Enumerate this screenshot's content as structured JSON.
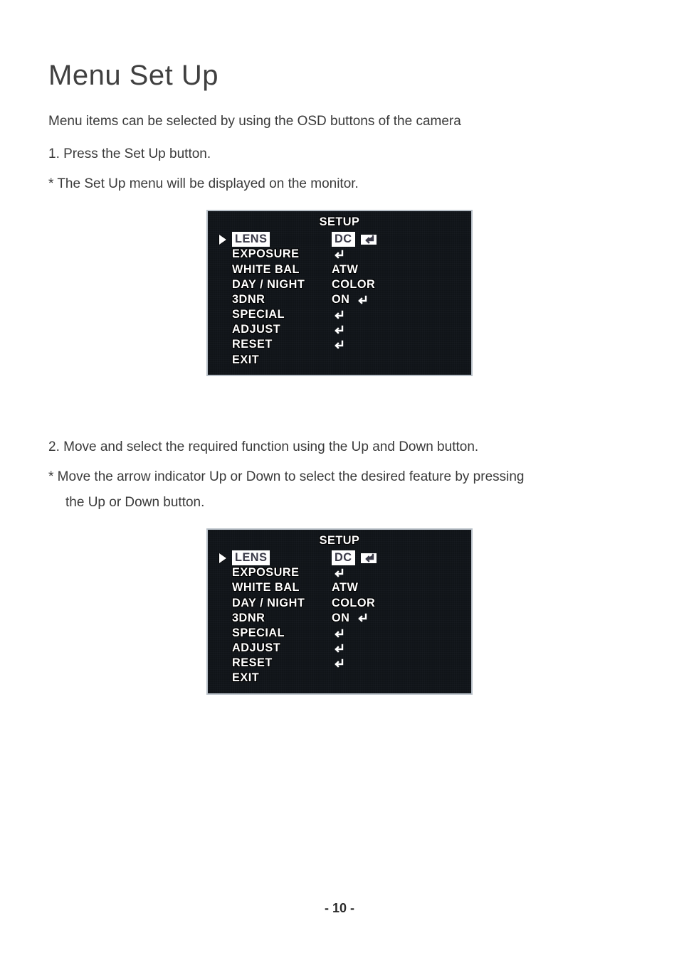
{
  "title": "Menu Set Up",
  "intro": "Menu items can be selected by using the OSD buttons of the camera",
  "step1": "1. Press the Set Up button.",
  "step1_note": "* The Set Up menu will be displayed on the monitor.",
  "step2": "2. Move and select the required function using the Up and Down button.",
  "step2_note": "* Move the arrow indicator Up or Down to select the desired feature by pressing",
  "step2_note_cont": "the Up or Down button.",
  "osd": {
    "title": "SETUP",
    "rows": [
      {
        "label": "LENS",
        "value": "DC",
        "enter": true,
        "selected": true
      },
      {
        "label": "EXPOSURE",
        "value": "",
        "enter": true
      },
      {
        "label": "WHITE BAL",
        "value": "ATW",
        "enter": false
      },
      {
        "label": "DAY / NIGHT",
        "value": "COLOR",
        "enter": false
      },
      {
        "label": "3DNR",
        "value": "ON",
        "enter": true
      },
      {
        "label": "SPECIAL",
        "value": "",
        "enter": true
      },
      {
        "label": "ADJUST",
        "value": "",
        "enter": true
      },
      {
        "label": "RESET",
        "value": "",
        "enter": true
      },
      {
        "label": "EXIT",
        "value": "",
        "enter": false
      }
    ]
  },
  "footer": "- 10 -"
}
